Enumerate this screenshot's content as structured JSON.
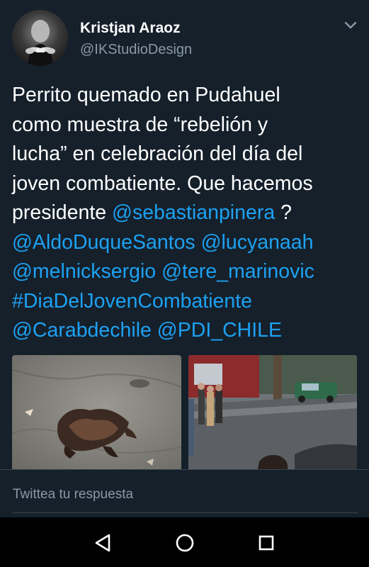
{
  "tweet": {
    "author": {
      "name": "Kristjan Araoz",
      "handle": "@IKStudioDesign"
    },
    "text": {
      "line1": "Perrito quemado en Pudahuel",
      "line2": "como muestra de “rebelión y",
      "line3": "lucha” en celebración del día del",
      "line4": "joven combatiente. Que hacemos",
      "line5_text": "presidente ",
      "mention_sebastianpinera": "@sebastianpinera",
      "line5_end": " ?",
      "mention_aldoduquesantos": "@AldoDuqueSantos",
      "mention_lucyanaah": "@lucyanaah",
      "mention_melnicksergio": "@melnicksergio",
      "mention_tere_marinovic": "@tere_marinovic",
      "hashtag_diadeljovencombatiente": "#DiaDelJovenCombatiente",
      "mention_carabdechile": "@Carabdechile",
      "mention_pdi_chile": "@PDI_CHILE"
    },
    "menu_icon": "chevron-down-icon"
  },
  "reply": {
    "placeholder": "Twittea tu respuesta"
  },
  "navigation": {
    "icons": [
      "back-triangle-icon",
      "home-circle-icon",
      "recents-square-icon"
    ]
  },
  "colors": {
    "background": "#15202b",
    "link": "#1da1f2",
    "secondary_text": "#8899a6",
    "divider": "#38444d",
    "nav_bar": "#000000"
  }
}
